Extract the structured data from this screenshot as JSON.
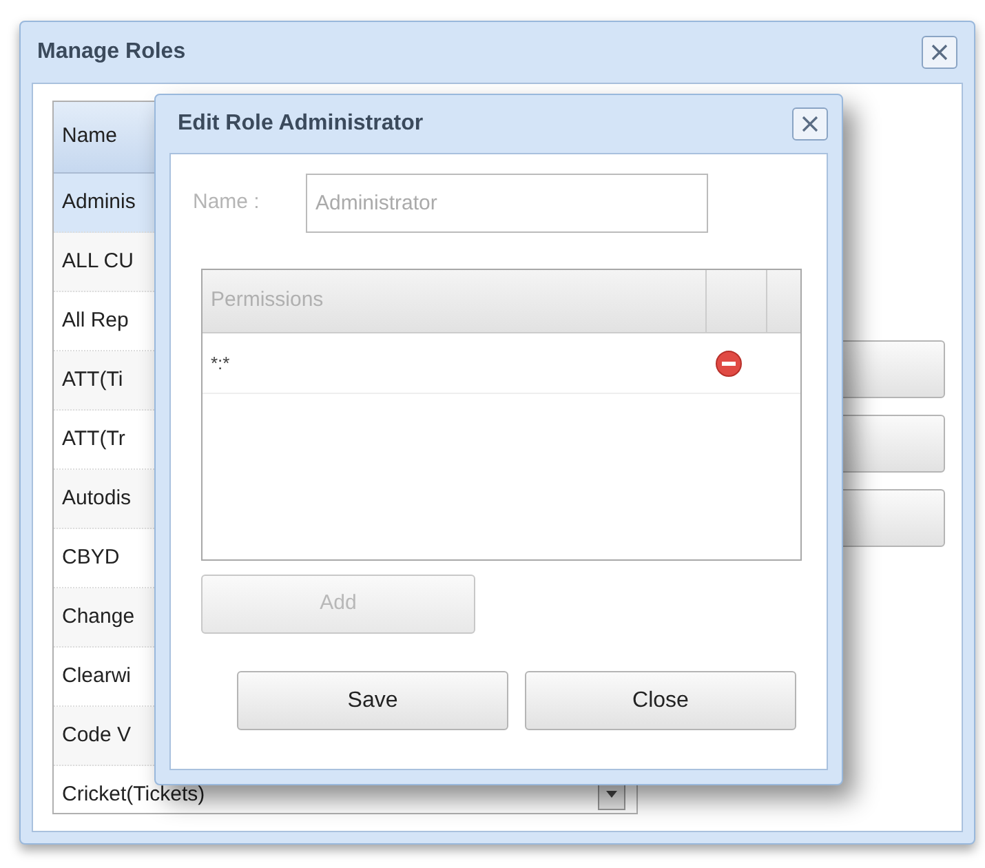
{
  "window": {
    "title": "Manage Roles"
  },
  "roles_list": {
    "columns": [
      "Name"
    ],
    "rows": [
      {
        "name": "Adminis",
        "selected": true
      },
      {
        "name": "ALL CU",
        "selected": false
      },
      {
        "name": "All Rep",
        "selected": false
      },
      {
        "name": "ATT(Ti",
        "selected": false
      },
      {
        "name": "ATT(Tr",
        "selected": false
      },
      {
        "name": "Autodis",
        "selected": false
      },
      {
        "name": "CBYD",
        "selected": false
      },
      {
        "name": "Change",
        "selected": false
      },
      {
        "name": "Clearwi",
        "selected": false
      },
      {
        "name": "Code V",
        "selected": false
      },
      {
        "name": "Cricket(Tickets)",
        "selected": false
      }
    ]
  },
  "edit_dialog": {
    "title": "Edit Role Administrator",
    "name_label": "Name :",
    "name_value": "Administrator",
    "permissions": {
      "columns": [
        "Permissions"
      ],
      "rows": [
        {
          "permission": "*:*"
        }
      ]
    },
    "add_button": {
      "label": "Add",
      "disabled": true
    },
    "buttons": [
      "Save",
      "Close"
    ]
  }
}
